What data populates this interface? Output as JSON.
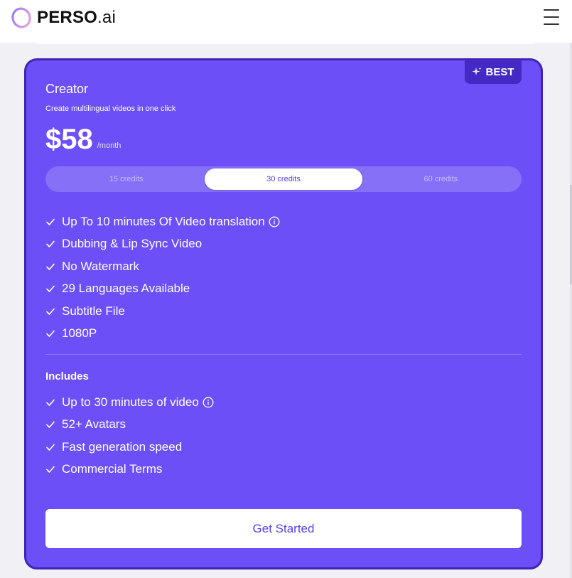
{
  "brand": {
    "name_main": "PERSO",
    "name_suffix": ".ai"
  },
  "header": {
    "menu_icon": "hamburger-menu-icon"
  },
  "plan": {
    "badge": "BEST",
    "name": "Creator",
    "subtitle": "Create multilingual videos in one click",
    "price": "$58",
    "period": "/month",
    "credit_options": [
      "15 credits",
      "30 credits",
      "60 credits"
    ],
    "selected_credit": "30 credits",
    "features": [
      "Up To 10 minutes Of Video translation",
      "Dubbing & Lip Sync Video",
      "No Watermark",
      "29 Languages Available",
      "Subtitle File",
      "1080P"
    ],
    "includes_title": "Includes",
    "includes": [
      "Up to 30 minutes of video",
      "52+ Avatars",
      "Fast generation speed",
      "Commercial Terms"
    ],
    "cta": "Get Started"
  },
  "colors": {
    "card_bg": "#6c4ff6",
    "card_border": "#3f25b5",
    "badge_bg": "#4429c4",
    "accent_text": "#5b3ee8"
  }
}
